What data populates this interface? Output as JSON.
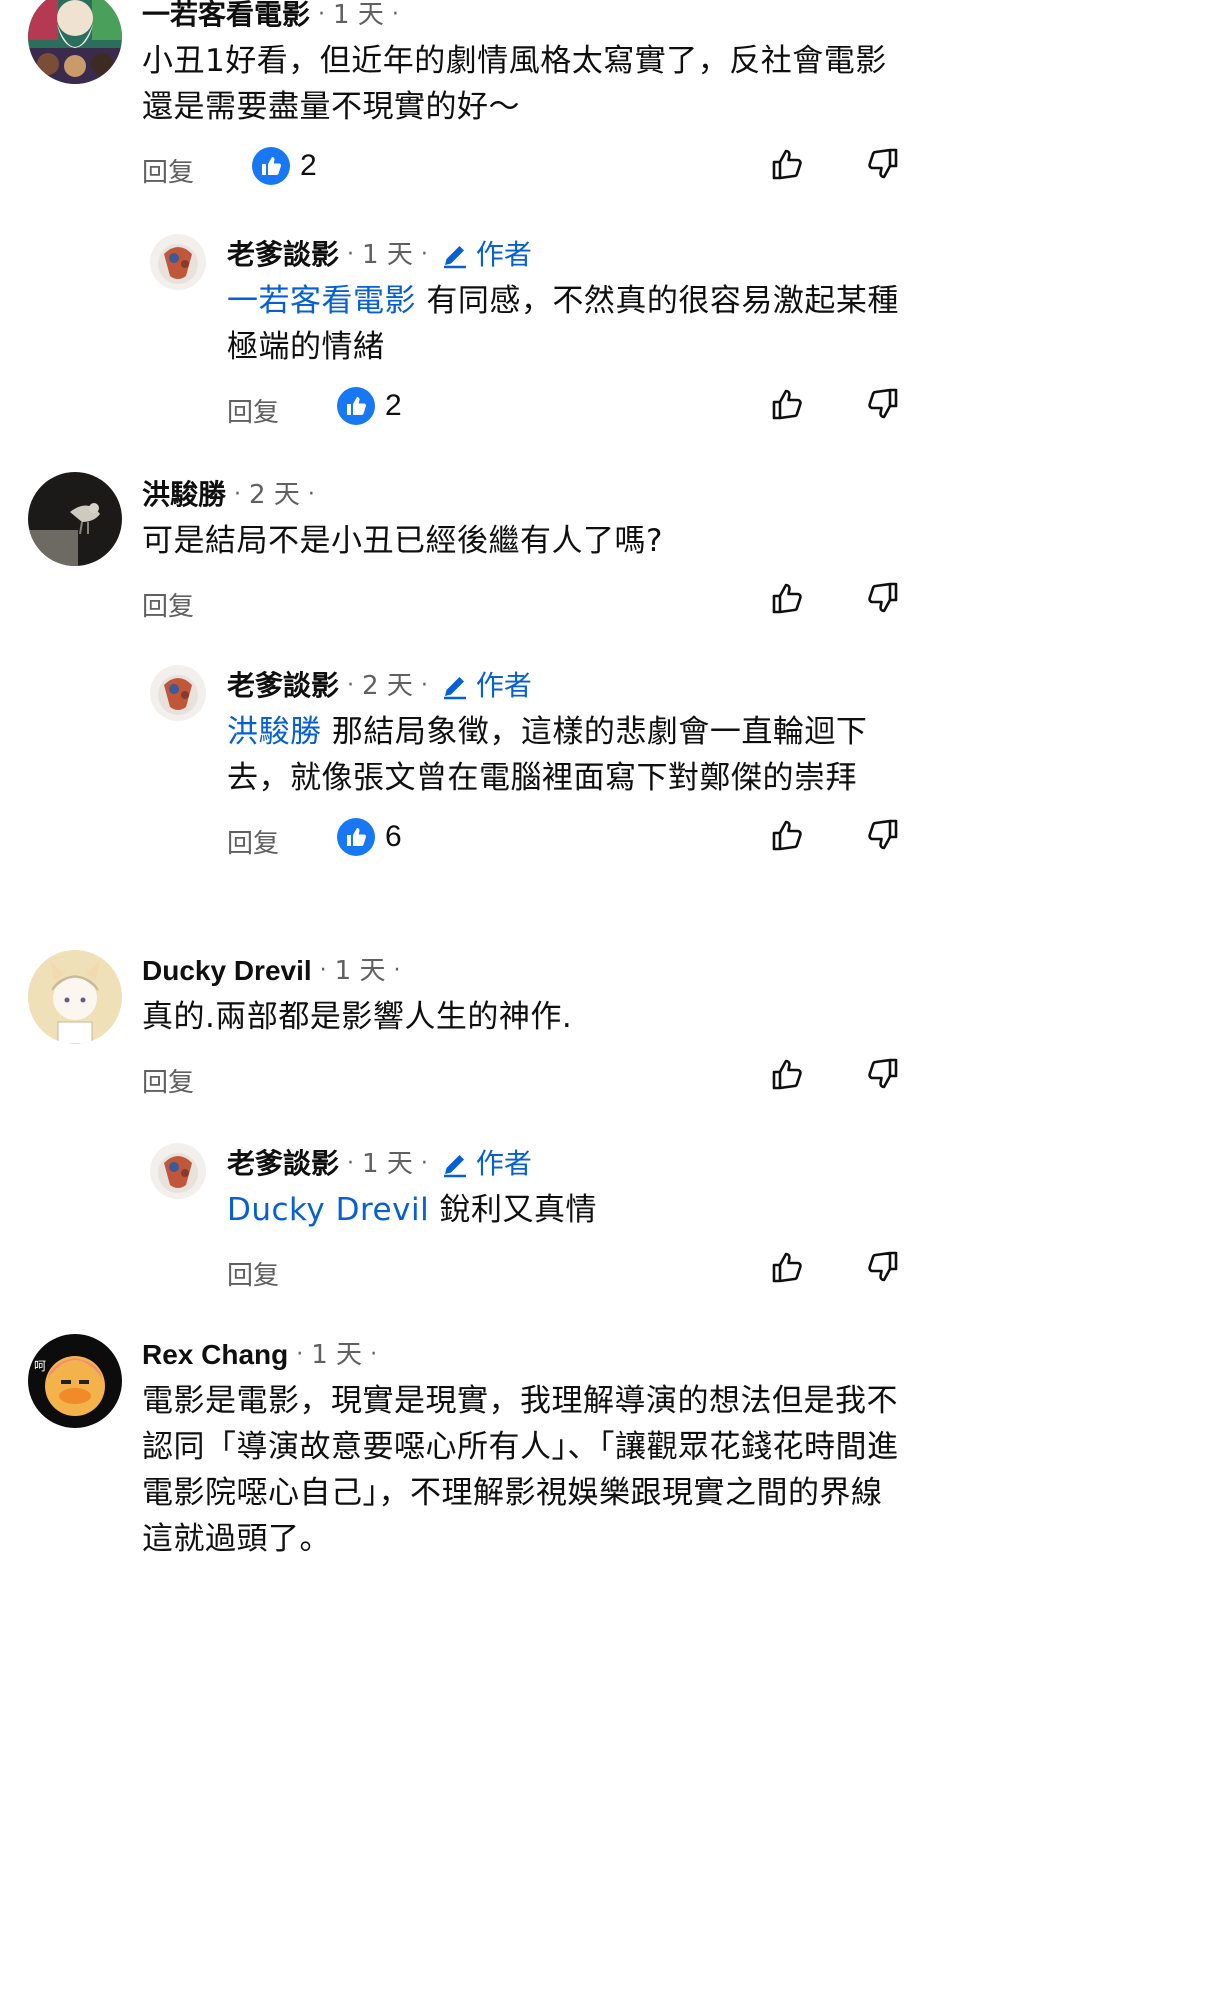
{
  "labels": {
    "reply": "回复",
    "creator": "作者"
  },
  "comments": [
    {
      "author": "一若客看電影",
      "time": "1 天",
      "text": "小丑1好看，但近年的劇情風格太寫實了，反社會電影還是需要盡量不現實的好～",
      "likes": "2"
    },
    {
      "author": "老爹談影",
      "time": "1 天",
      "mention": "一若客看電影",
      "text": " 有同感，不然真的很容易激起某種極端的情緒",
      "likes": "2"
    },
    {
      "author": "洪駿勝",
      "time": "2 天",
      "text": "可是結局不是小丑已經後繼有人了嗎?"
    },
    {
      "author": "老爹談影",
      "time": "2 天",
      "mention": "洪駿勝",
      "text": " 那結局象徵，這樣的悲劇會一直輪迴下去，就像張文曾在電腦裡面寫下對鄭傑的崇拜",
      "likes": "6"
    },
    {
      "author": "Ducky Drevil",
      "time": "1 天",
      "text": "真的.兩部都是影響人生的神作."
    },
    {
      "author": "老爹談影",
      "time": "1 天",
      "mention": "Ducky Drevil",
      "text": " 銳利又真情"
    },
    {
      "author": "Rex Chang",
      "time": "1 天",
      "text": "電影是電影，現實是現實，我理解導演的想法但是我不認同「導演故意要噁心所有人」、「讓觀眾花錢花時間進電影院噁心自己」，不理解影視娛樂跟現實之間的界線這就過頭了。"
    }
  ],
  "colors": {
    "link_blue": "#065fd4",
    "like_badge_blue": "#1877f2",
    "secondary_text": "#606060"
  }
}
